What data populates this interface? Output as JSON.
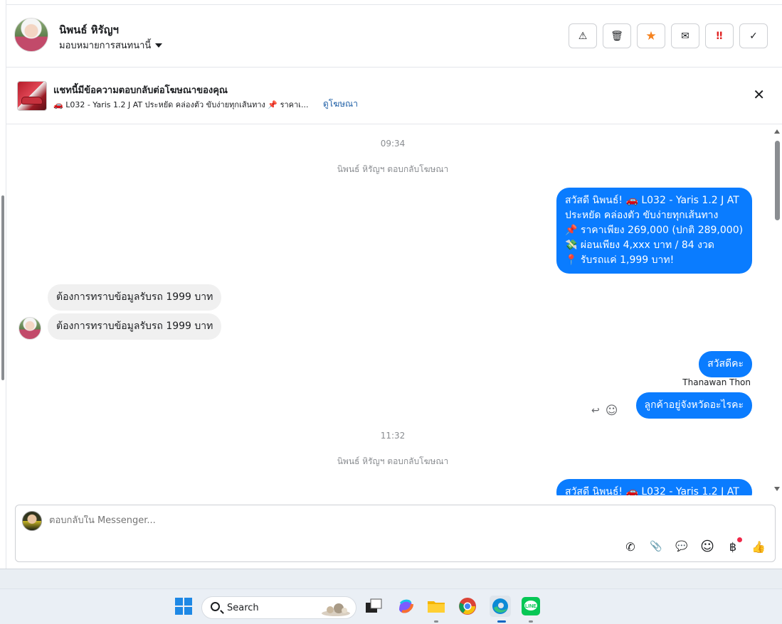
{
  "header": {
    "contact_name": "นิพนธ์ หิรัญฯ",
    "assign_label": "มอบหมายการสนทนานี้",
    "actions": [
      {
        "icon": "warning-icon",
        "glyph": "⚠"
      },
      {
        "icon": "trash-icon",
        "glyph": "🗑"
      },
      {
        "icon": "star-icon",
        "glyph": "★"
      },
      {
        "icon": "envelope-icon",
        "glyph": "✉"
      },
      {
        "icon": "double-exclamation-icon",
        "glyph": "‼"
      },
      {
        "icon": "check-icon",
        "glyph": "✓"
      }
    ]
  },
  "ad_banner": {
    "title": "แชทนี้มีข้อความตอบกลับต่อโฆษณาของคุณ",
    "subtitle": "🚗 L032 - Yaris 1.2 J AT ประหยัด คล่องตัว ขับง่ายทุกเส้นทาง 📌 ราคาเ...",
    "link": "ดูโฆษณา",
    "close": "✕"
  },
  "chat": {
    "time_1": "09:34",
    "sys_1": "นิพนธ์ หิรัญฯ ตอบกลับโฆษณา",
    "out_1": [
      "สวัสดี นิพนธ์! 🚗 L032 - Yaris 1.2 J AT",
      "ประหยัด คล่องตัว ขับง่ายทุกเส้นทาง",
      "📌 ราคาเพียง 269,000 (ปกติ 289,000)",
      "💸 ผ่อนเพียง 4,xxx บาท / 84 งวด",
      "📍 รับรถแค่ 1,999 บาท!"
    ],
    "in_1": "ต้องการทราบข้อมูลรับรถ 1999 บาท",
    "in_2": "ต้องการทราบข้อมูลรับรถ 1999 บาท",
    "out_2": "สวัสดีคะ",
    "sender_name": "Thanawan Thon",
    "out_3": "ลูกค้าอยู่จังหวัดอะไรคะ",
    "reply_icon": "↩",
    "emoji_icon": "☺",
    "time_2": "11:32",
    "sys_2": "นิพนธ์ หิรัญฯ ตอบกลับโฆษณา",
    "out_4_partial": "สวัสดี นิพนธ์! 🚗 L032 - Yaris 1.2 J AT"
  },
  "composer": {
    "placeholder": "ตอบกลับใน Messenger...",
    "tools": [
      {
        "icon": "phone-plus-icon",
        "glyph": "✆"
      },
      {
        "icon": "paperclip-icon",
        "glyph": "📎"
      },
      {
        "icon": "chat-bubble-icon",
        "glyph": "💬"
      },
      {
        "icon": "smiley-icon",
        "glyph": "☺"
      },
      {
        "icon": "baht-icon",
        "glyph": "฿"
      },
      {
        "icon": "thumbs-up-icon",
        "glyph": "👍"
      }
    ]
  },
  "taskbar": {
    "search_label": "Search"
  },
  "colors": {
    "outgoing_bubble": "#0a7cff",
    "incoming_bubble": "#f0f0f0",
    "star": "#f5821f",
    "alert": "#e02424",
    "link": "#1f5fa6"
  }
}
